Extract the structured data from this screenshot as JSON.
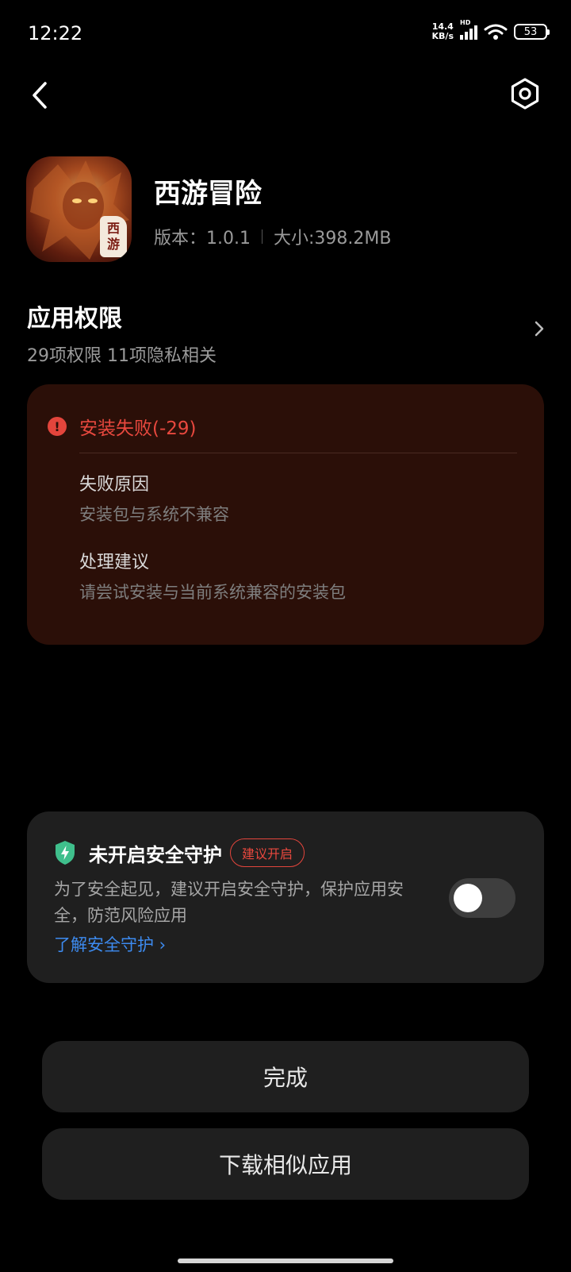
{
  "status_bar": {
    "time": "12:22",
    "net_speed_value": "14.4",
    "net_speed_unit": "KB/s",
    "signal_label": "HD",
    "battery": "53"
  },
  "app": {
    "name": "西游冒险",
    "version": "版本：1.0.1",
    "size": "大小:398.2MB",
    "icon_badge_top": "西",
    "icon_badge_bottom": "游"
  },
  "permissions": {
    "title": "应用权限",
    "summary": "29项权限 11项隐私相关"
  },
  "error": {
    "title": "安装失败(-29)",
    "reason_label": "失败原因",
    "reason_text": "安装包与系统不兼容",
    "advice_label": "处理建议",
    "advice_text": "请尝试安装与当前系统兼容的安装包",
    "color": "#e8483e"
  },
  "security": {
    "title": "未开启安全守护",
    "tag": "建议开启",
    "description": "为了安全起见，建议开启安全守护，保护应用安全，防范风险应用",
    "link": "了解安全守护 ›",
    "toggle_on": false,
    "link_color": "#3d8bf0"
  },
  "buttons": {
    "done": "完成",
    "download_similar": "下载相似应用"
  },
  "icons": {
    "back": "chevron-left-icon",
    "settings": "gear-icon",
    "error": "exclamation-circle-icon",
    "shield": "shield-bolt-icon",
    "forward": "chevron-right-icon"
  }
}
